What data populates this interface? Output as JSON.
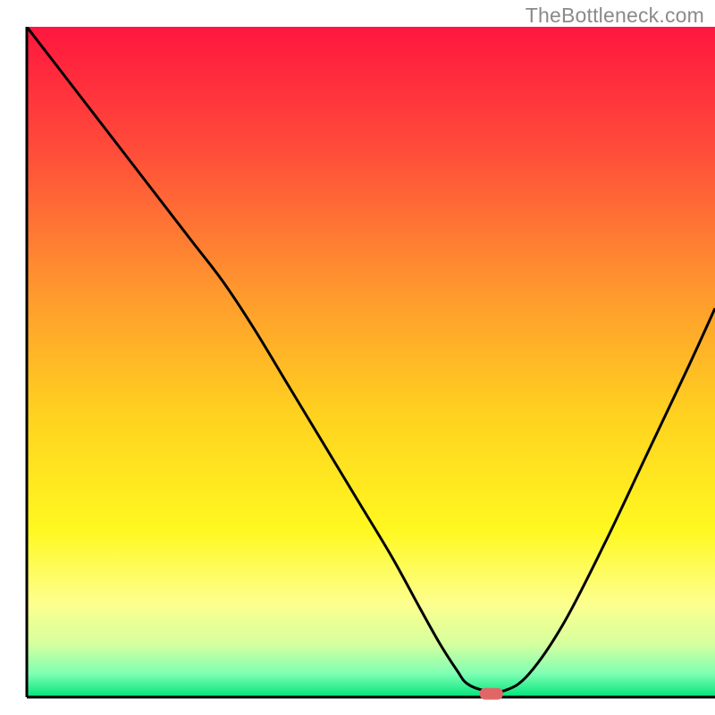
{
  "watermark": "TheBottleneck.com",
  "chart_data": {
    "type": "line",
    "title": "",
    "xlabel": "",
    "ylabel": "",
    "xlim": [
      0,
      100
    ],
    "ylim": [
      0,
      100
    ],
    "grid": false,
    "legend": false,
    "background_gradient": {
      "direction": "vertical",
      "stops": [
        {
          "pos": 0.0,
          "color": "#ff163f"
        },
        {
          "pos": 0.18,
          "color": "#ff4b3a"
        },
        {
          "pos": 0.4,
          "color": "#ff9a2e"
        },
        {
          "pos": 0.58,
          "color": "#ffd21f"
        },
        {
          "pos": 0.75,
          "color": "#fff820"
        },
        {
          "pos": 0.86,
          "color": "#fdff8e"
        },
        {
          "pos": 0.92,
          "color": "#d7ff9e"
        },
        {
          "pos": 0.965,
          "color": "#7fffb4"
        },
        {
          "pos": 1.0,
          "color": "#00e47a"
        }
      ]
    },
    "axis_color": "#000000",
    "series": [
      {
        "name": "bottleneck-curve",
        "color": "#000000",
        "x": [
          0.0,
          6,
          12,
          18,
          24,
          28.5,
          33,
          38,
          43,
          48,
          53,
          57,
          60,
          62.5,
          64,
          66.5,
          69.5,
          73,
          78,
          84,
          90,
          96,
          100
        ],
        "y": [
          100,
          92,
          84,
          76,
          68,
          62,
          55,
          46.5,
          38,
          29.5,
          21,
          13.5,
          8,
          4,
          2,
          1,
          1,
          3.5,
          11,
          23,
          36,
          49,
          58
        ]
      }
    ],
    "marker": {
      "name": "optimal-point",
      "x": 67.5,
      "y": 0.5,
      "color": "#e16666",
      "shape": "pill"
    }
  }
}
